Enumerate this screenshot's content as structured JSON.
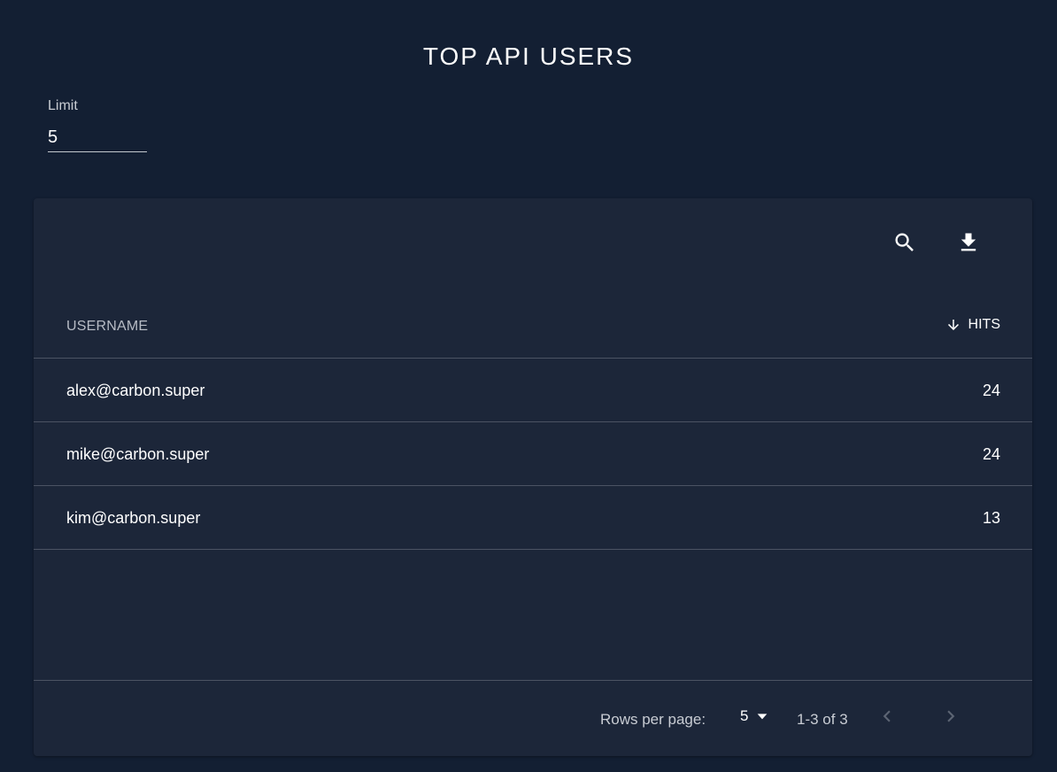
{
  "page": {
    "title": "TOP API USERS"
  },
  "limit": {
    "label": "Limit",
    "value": "5"
  },
  "toolbar": {
    "search_icon": "search-icon",
    "download_icon": "download-icon"
  },
  "table": {
    "columns": {
      "username": "USERNAME",
      "hits": "HITS",
      "hits_sort": "descending"
    },
    "rows": [
      {
        "username": "alex@carbon.super",
        "hits": "24"
      },
      {
        "username": "mike@carbon.super",
        "hits": "24"
      },
      {
        "username": "kim@carbon.super",
        "hits": "13"
      }
    ]
  },
  "pagination": {
    "rows_per_page_label": "Rows per page:",
    "rows_per_page_value": "5",
    "range": "1-3 of 3"
  },
  "colors": {
    "background": "#131f33",
    "card": "#1c2639",
    "divider": "#4b5363",
    "text_primary": "#ffffff",
    "text_secondary": "#c8ccd3"
  }
}
